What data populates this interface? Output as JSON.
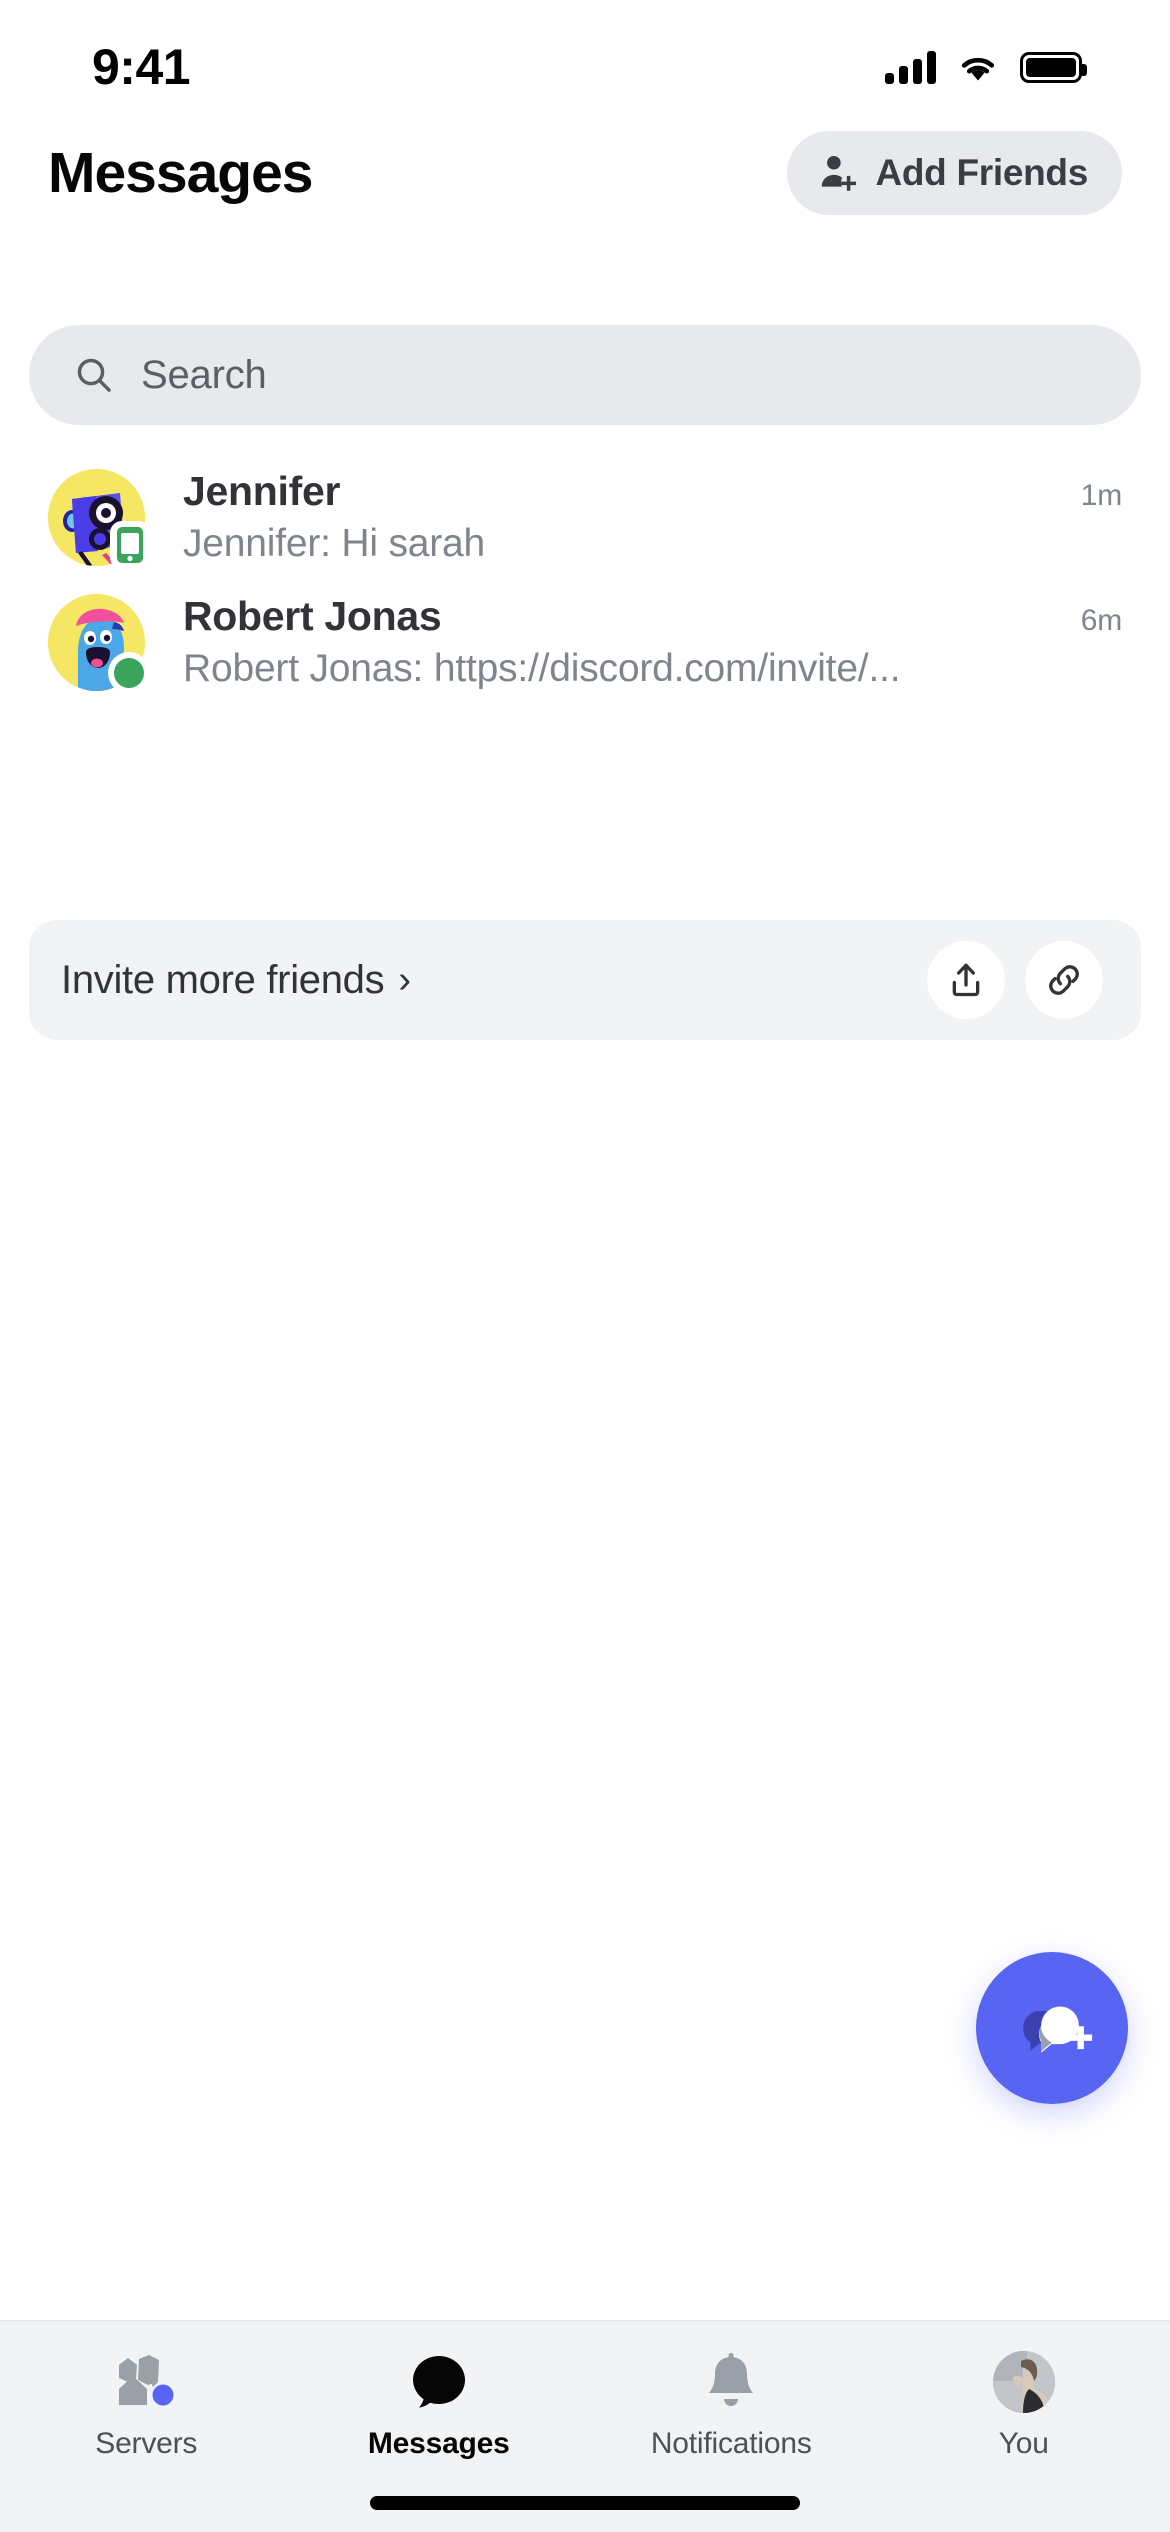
{
  "status_bar": {
    "time": "9:41",
    "signal_icon": "cellular-bars-icon",
    "wifi_icon": "wifi-icon",
    "battery_icon": "battery-full-icon"
  },
  "header": {
    "title": "Messages",
    "add_friends_label": "Add Friends",
    "add_friends_icon": "person-add-icon"
  },
  "search": {
    "placeholder": "Search",
    "icon": "search-icon",
    "value": ""
  },
  "conversations": [
    {
      "name": "Jennifer",
      "preview": "Jennifer: Hi sarah",
      "time": "1m",
      "status": "mobile",
      "status_icon": "mobile-phone-icon",
      "avatar_name": "avatar-jennifer",
      "avatar_bg": "#f5e663"
    },
    {
      "name": "Robert Jonas",
      "preview": "Robert Jonas: https://discord.com/invite/...",
      "time": "6m",
      "status": "online",
      "status_icon": "online-dot-icon",
      "avatar_name": "avatar-robert-jonas",
      "avatar_bg": "#f5e663"
    }
  ],
  "invite_card": {
    "label": "Invite more friends",
    "chevron": "›",
    "share_icon": "share-icon",
    "link_icon": "link-icon"
  },
  "fab": {
    "icon": "new-message-icon",
    "color": "#5865f2"
  },
  "tabs": [
    {
      "label": "Servers",
      "icon": "servers-icon",
      "active": false,
      "has_badge": true
    },
    {
      "label": "Messages",
      "icon": "message-bubble-icon",
      "active": true,
      "has_badge": false
    },
    {
      "label": "Notifications",
      "icon": "bell-icon",
      "active": false,
      "has_badge": false
    },
    {
      "label": "You",
      "icon": "user-avatar-icon",
      "active": false,
      "has_badge": false
    }
  ],
  "colors": {
    "accent": "#5865f2",
    "online": "#3ba55c",
    "mobile": "#3ba55c",
    "text_primary": "#313338",
    "text_muted": "#80848e",
    "surface": "#e8e9ec",
    "tabbar_bg": "#f2f3f5"
  }
}
